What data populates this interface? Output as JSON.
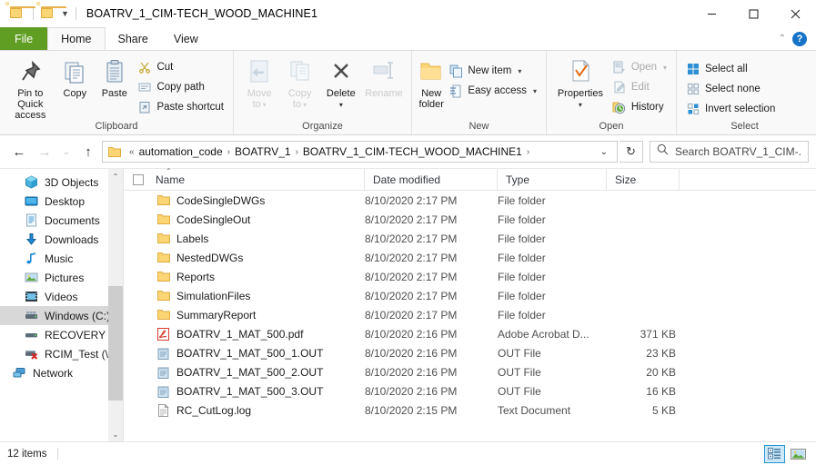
{
  "window": {
    "title": "BOATRV_1_CIM-TECH_WOOD_MACHINE1",
    "quick_access": {
      "folder_icon": "folder-icon",
      "customize_caret": "▼"
    },
    "controls": {
      "minimize": "minimize-icon",
      "maximize": "maximize-icon",
      "close": "close-icon"
    }
  },
  "ribbon": {
    "tabs": [
      {
        "label": "File",
        "id": "file"
      },
      {
        "label": "Home",
        "id": "home"
      },
      {
        "label": "Share",
        "id": "share"
      },
      {
        "label": "View",
        "id": "view"
      }
    ],
    "active_tab": "Home",
    "collapse_caret": "⌃",
    "help_label": "?",
    "groups": [
      {
        "name": "Clipboard",
        "big": [
          {
            "label": "Pin to Quick\naccess",
            "line1": "Pin to Quick",
            "line2": "access",
            "icon": "pin-icon",
            "disabled": false
          },
          {
            "label": "Copy",
            "line1": "Copy",
            "line2": "",
            "icon": "copy-icon",
            "disabled": false
          },
          {
            "label": "Paste",
            "line1": "Paste",
            "line2": "",
            "icon": "paste-icon",
            "disabled": false
          }
        ],
        "small": [
          {
            "label": "Cut",
            "icon": "scissors-icon",
            "disabled": false
          },
          {
            "label": "Copy path",
            "icon": "copy-path-icon",
            "disabled": false
          },
          {
            "label": "Paste shortcut",
            "icon": "paste-shortcut-icon",
            "disabled": false
          }
        ]
      },
      {
        "name": "Organize",
        "big": [
          {
            "line1": "Move",
            "line2": "to",
            "icon": "move-to-icon",
            "dropdown": "▾",
            "disabled": true
          },
          {
            "line1": "Copy",
            "line2": "to",
            "icon": "copy-to-icon",
            "dropdown": "▾",
            "disabled": true
          },
          {
            "line1": "Delete",
            "line2": "",
            "icon": "delete-icon",
            "dropdown": "▾",
            "disabled": false
          },
          {
            "line1": "Rename",
            "line2": "",
            "icon": "rename-icon",
            "disabled": true
          }
        ],
        "small": []
      },
      {
        "name": "New",
        "big": [
          {
            "line1": "New",
            "line2": "folder",
            "icon": "new-folder-icon",
            "disabled": false
          }
        ],
        "small": [
          {
            "label": "New item",
            "icon": "new-item-icon",
            "dropdown": "▾",
            "disabled": false
          },
          {
            "label": "Easy access",
            "icon": "easy-access-icon",
            "dropdown": "▾",
            "disabled": false
          }
        ]
      },
      {
        "name": "Open",
        "big": [
          {
            "line1": "Properties",
            "line2": "",
            "icon": "properties-icon",
            "dropdown": "▾",
            "disabled": false
          }
        ],
        "small": [
          {
            "label": "Open",
            "icon": "open-icon",
            "dropdown": "▾",
            "disabled": true
          },
          {
            "label": "Edit",
            "icon": "edit-icon",
            "disabled": true
          },
          {
            "label": "History",
            "icon": "history-icon",
            "disabled": false
          }
        ]
      },
      {
        "name": "Select",
        "big": [],
        "small": [
          {
            "label": "Select all",
            "icon": "select-all-icon",
            "disabled": false
          },
          {
            "label": "Select none",
            "icon": "select-none-icon",
            "disabled": false
          },
          {
            "label": "Invert selection",
            "icon": "invert-selection-icon",
            "disabled": false
          }
        ]
      }
    ]
  },
  "addressbar": {
    "back": "←",
    "forward": "→",
    "recent": "⌄",
    "up": "↑",
    "overflow": "«",
    "breadcrumbs": [
      {
        "label": "automation_code"
      },
      {
        "label": "BOATRV_1"
      },
      {
        "label": "BOATRV_1_CIM-TECH_WOOD_MACHINE1"
      }
    ],
    "separator": "›",
    "history_caret": "⌄",
    "refresh": "↻",
    "search": {
      "placeholder": "Search BOATRV_1_CIM-...",
      "icon": "search-icon"
    }
  },
  "navpane": {
    "items": [
      {
        "label": "3D Objects",
        "icon": "3d-objects-icon",
        "selected": false,
        "root": false
      },
      {
        "label": "Desktop",
        "icon": "desktop-icon",
        "selected": false,
        "root": false
      },
      {
        "label": "Documents",
        "icon": "documents-icon",
        "selected": false,
        "root": false
      },
      {
        "label": "Downloads",
        "icon": "downloads-icon",
        "selected": false,
        "root": false
      },
      {
        "label": "Music",
        "icon": "music-icon",
        "selected": false,
        "root": false
      },
      {
        "label": "Pictures",
        "icon": "pictures-icon",
        "selected": false,
        "root": false
      },
      {
        "label": "Videos",
        "icon": "videos-icon",
        "selected": false,
        "root": false
      },
      {
        "label": "Windows (C:)",
        "icon": "drive-icon",
        "selected": true,
        "root": false
      },
      {
        "label": "RECOVERY (D:)",
        "icon": "drive-icon",
        "selected": false,
        "root": false
      },
      {
        "label": "RCIM_Test (\\\\Cir",
        "icon": "network-drive-disconnected-icon",
        "selected": false,
        "root": false
      },
      {
        "label": "Network",
        "icon": "network-icon",
        "selected": false,
        "root": true
      }
    ],
    "scrollbar": {
      "up": "⌃",
      "down": "⌄"
    }
  },
  "filelist": {
    "columns": [
      {
        "key": "name",
        "label": "Name",
        "sorted": "asc"
      },
      {
        "key": "date",
        "label": "Date modified"
      },
      {
        "key": "type",
        "label": "Type"
      },
      {
        "key": "size",
        "label": "Size"
      }
    ],
    "sort_marker": "⌃",
    "rows": [
      {
        "name": "CodeSingleDWGs",
        "date": "8/10/2020 2:17 PM",
        "type": "File folder",
        "size": "",
        "icon": "folder-icon"
      },
      {
        "name": "CodeSingleOut",
        "date": "8/10/2020 2:17 PM",
        "type": "File folder",
        "size": "",
        "icon": "folder-icon"
      },
      {
        "name": "Labels",
        "date": "8/10/2020 2:17 PM",
        "type": "File folder",
        "size": "",
        "icon": "folder-icon"
      },
      {
        "name": "NestedDWGs",
        "date": "8/10/2020 2:17 PM",
        "type": "File folder",
        "size": "",
        "icon": "folder-icon"
      },
      {
        "name": "Reports",
        "date": "8/10/2020 2:17 PM",
        "type": "File folder",
        "size": "",
        "icon": "folder-icon"
      },
      {
        "name": "SimulationFiles",
        "date": "8/10/2020 2:17 PM",
        "type": "File folder",
        "size": "",
        "icon": "folder-icon"
      },
      {
        "name": "SummaryReport",
        "date": "8/10/2020 2:17 PM",
        "type": "File folder",
        "size": "",
        "icon": "folder-icon"
      },
      {
        "name": "BOATRV_1_MAT_500.pdf",
        "date": "8/10/2020 2:16 PM",
        "type": "Adobe Acrobat D...",
        "size": "371 KB",
        "icon": "pdf-icon"
      },
      {
        "name": "BOATRV_1_MAT_500_1.OUT",
        "date": "8/10/2020 2:16 PM",
        "type": "OUT File",
        "size": "23 KB",
        "icon": "out-file-icon"
      },
      {
        "name": "BOATRV_1_MAT_500_2.OUT",
        "date": "8/10/2020 2:16 PM",
        "type": "OUT File",
        "size": "20 KB",
        "icon": "out-file-icon"
      },
      {
        "name": "BOATRV_1_MAT_500_3.OUT",
        "date": "8/10/2020 2:16 PM",
        "type": "OUT File",
        "size": "16 KB",
        "icon": "out-file-icon"
      },
      {
        "name": "RC_CutLog.log",
        "date": "8/10/2020 2:15 PM",
        "type": "Text Document",
        "size": "5 KB",
        "icon": "text-document-icon"
      }
    ]
  },
  "statusbar": {
    "item_count": "12 items",
    "views": [
      {
        "name": "details-view",
        "active": true
      },
      {
        "name": "large-icons-view",
        "active": false
      }
    ]
  },
  "colors": {
    "file_tab_green": "#5f9e23",
    "folder_yellow": "#fcd675",
    "accent_blue": "#2196d3",
    "selection_gray": "#d8d8d8",
    "help_blue": "#1673c8"
  }
}
